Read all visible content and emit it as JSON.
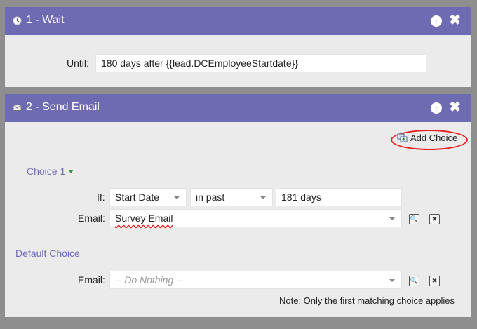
{
  "wait": {
    "title": "1 - Wait",
    "until_label": "Until:",
    "until_value": "180  days after {{lead.DCEmployeeStartdate}}"
  },
  "send": {
    "title": "2 - Send Email",
    "add_choice": "Add Choice",
    "choice1": "Choice 1",
    "if_label": "If:",
    "attribute": "Start Date",
    "operator": "in past",
    "value": "181 days",
    "email_label": "Email:",
    "email_value": "Survey Email",
    "default_choice": "Default Choice",
    "default_email_label": "Email:",
    "default_email_placeholder": "-- Do Nothing --",
    "note": "Note: Only the first matching choice applies"
  },
  "icons": {
    "wait": "clock-icon",
    "send": "email-icon",
    "up": "arrow-up-icon",
    "close": "close-icon",
    "add": "add-choice-icon",
    "preview": "preview-icon",
    "delete": "delete-icon"
  },
  "colors": {
    "header": "#6f6bb3",
    "annotation": "#e8201f",
    "background": "#8e8e8e",
    "panel": "#ebebeb"
  }
}
